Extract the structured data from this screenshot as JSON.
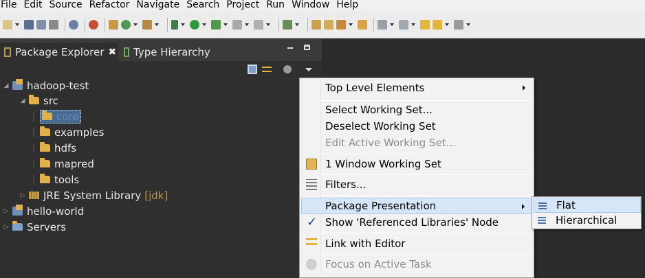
{
  "menubar": {
    "items": [
      "File",
      "Edit",
      "Source",
      "Refactor",
      "Navigate",
      "Search",
      "Project",
      "Run",
      "Window",
      "Help"
    ]
  },
  "pane": {
    "tabs": [
      {
        "label": "Package Explorer",
        "close": "✖"
      },
      {
        "label": "Type Hierarchy"
      }
    ]
  },
  "tree": {
    "items": [
      {
        "label": "hadoop-test"
      },
      {
        "label": "src"
      },
      {
        "label": "core"
      },
      {
        "label": "examples"
      },
      {
        "label": "hdfs"
      },
      {
        "label": "mapred"
      },
      {
        "label": "tools"
      },
      {
        "label": "JRE System Library",
        "suffix": "[jdk]"
      },
      {
        "label": "hello-world"
      },
      {
        "label": "Servers"
      }
    ]
  },
  "menu": {
    "items": [
      {
        "label": "Top Level Elements"
      },
      {
        "label": "Select Working Set..."
      },
      {
        "label": "Deselect Working Set"
      },
      {
        "label": "Edit Active Working Set..."
      },
      {
        "label": "1 Window Working Set"
      },
      {
        "label": "Filters..."
      },
      {
        "label": "Package Presentation"
      },
      {
        "label": "Show 'Referenced Libraries' Node"
      },
      {
        "label": "Link with Editor"
      },
      {
        "label": "Focus on Active Task"
      }
    ],
    "check_glyph": "✓"
  },
  "submenu": {
    "items": [
      {
        "label": "Flat"
      },
      {
        "label": "Hierarchical"
      }
    ]
  },
  "colors": {
    "selection": "#d6e6f8",
    "pane_bg": "#2f2f2f",
    "folder": "#e0b04a"
  }
}
